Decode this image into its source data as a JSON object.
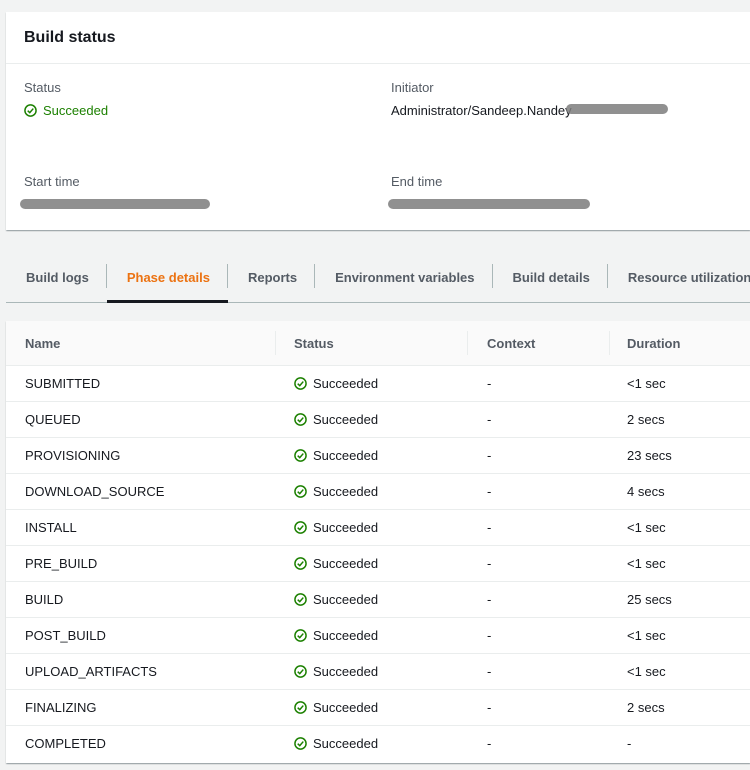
{
  "build_status": {
    "title": "Build status",
    "status_label": "Status",
    "status_value": "Succeeded",
    "initiator_label": "Initiator",
    "initiator_value": "Administrator/Sandeep.Nandey",
    "start_time_label": "Start time",
    "end_time_label": "End time"
  },
  "tabs": [
    {
      "label": "Build logs",
      "active": false
    },
    {
      "label": "Phase details",
      "active": true
    },
    {
      "label": "Reports",
      "active": false
    },
    {
      "label": "Environment variables",
      "active": false
    },
    {
      "label": "Build details",
      "active": false
    },
    {
      "label": "Resource utilization",
      "active": false
    }
  ],
  "phases": {
    "columns": [
      "Name",
      "Status",
      "Context",
      "Duration"
    ],
    "rows": [
      {
        "name": "SUBMITTED",
        "status": "Succeeded",
        "context": "-",
        "duration": "<1 sec"
      },
      {
        "name": "QUEUED",
        "status": "Succeeded",
        "context": "-",
        "duration": "2 secs"
      },
      {
        "name": "PROVISIONING",
        "status": "Succeeded",
        "context": "-",
        "duration": "23 secs"
      },
      {
        "name": "DOWNLOAD_SOURCE",
        "status": "Succeeded",
        "context": "-",
        "duration": "4 secs"
      },
      {
        "name": "INSTALL",
        "status": "Succeeded",
        "context": "-",
        "duration": "<1 sec"
      },
      {
        "name": "PRE_BUILD",
        "status": "Succeeded",
        "context": "-",
        "duration": "<1 sec"
      },
      {
        "name": "BUILD",
        "status": "Succeeded",
        "context": "-",
        "duration": "25 secs"
      },
      {
        "name": "POST_BUILD",
        "status": "Succeeded",
        "context": "-",
        "duration": "<1 sec"
      },
      {
        "name": "UPLOAD_ARTIFACTS",
        "status": "Succeeded",
        "context": "-",
        "duration": "<1 sec"
      },
      {
        "name": "FINALIZING",
        "status": "Succeeded",
        "context": "-",
        "duration": "2 secs"
      },
      {
        "name": "COMPLETED",
        "status": "Succeeded",
        "context": "-",
        "duration": "-"
      }
    ]
  },
  "colors": {
    "success": "#1d8102",
    "active_tab": "#ec7211"
  }
}
